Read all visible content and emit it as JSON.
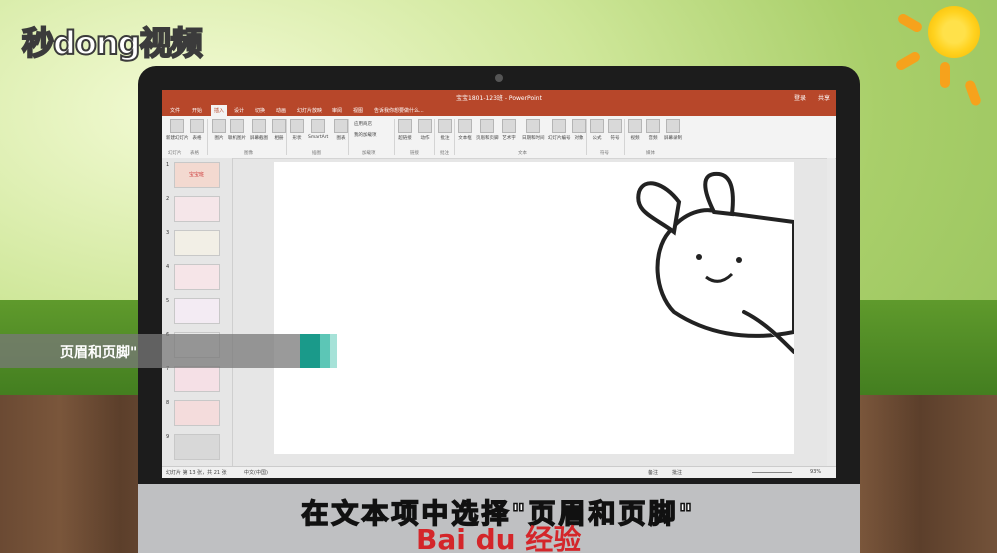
{
  "logo": {
    "text": "秒dong视频"
  },
  "window": {
    "title": "宝宝1801-123班 - PowerPoint"
  },
  "tabs": [
    "文件",
    "开始",
    "插入",
    "设计",
    "切换",
    "动画",
    "幻灯片放映",
    "审阅",
    "视图",
    "告诉我你想要做什么..."
  ],
  "active_tab_index": 2,
  "account": {
    "login": "登录",
    "share": "共享"
  },
  "ribbon": {
    "buttons": [
      "新建幻灯片",
      "表格",
      "图片",
      "联机图片",
      "屏幕截图",
      "相册",
      "形状",
      "SmartArt",
      "图表",
      "应用商店",
      "我的加载项",
      "超链接",
      "动作",
      "批注",
      "文本框",
      "页眉和页脚",
      "艺术字",
      "日期和时间",
      "幻灯片编号",
      "对象",
      "公式",
      "符号",
      "视频",
      "音频",
      "屏幕录制"
    ],
    "groups": [
      "幻灯片",
      "表格",
      "图像",
      "插图",
      "加载项",
      "链接",
      "批注",
      "文本",
      "符号",
      "媒体"
    ]
  },
  "thumbnails": [
    {
      "num": "1",
      "label": "宝宝班"
    },
    {
      "num": "2",
      "label": ""
    },
    {
      "num": "3",
      "label": ""
    },
    {
      "num": "4",
      "label": ""
    },
    {
      "num": "5",
      "label": ""
    },
    {
      "num": "6",
      "label": ""
    },
    {
      "num": "7",
      "label": ""
    },
    {
      "num": "8",
      "label": ""
    },
    {
      "num": "9",
      "label": ""
    }
  ],
  "status": {
    "slide": "幻灯片 第 13 张，共 21 张",
    "lang": "中文(中国)",
    "notes": "备注",
    "comments": "批注",
    "zoom": "93%"
  },
  "highlight": {
    "text": "页眉和页脚\""
  },
  "subtitle": {
    "text": "在文本项中选择\"页眉和页脚\""
  },
  "watermark": {
    "text": "Bai du 经验"
  },
  "colors": {
    "accent": "#b7472a",
    "teal": "#1a9a8a"
  }
}
